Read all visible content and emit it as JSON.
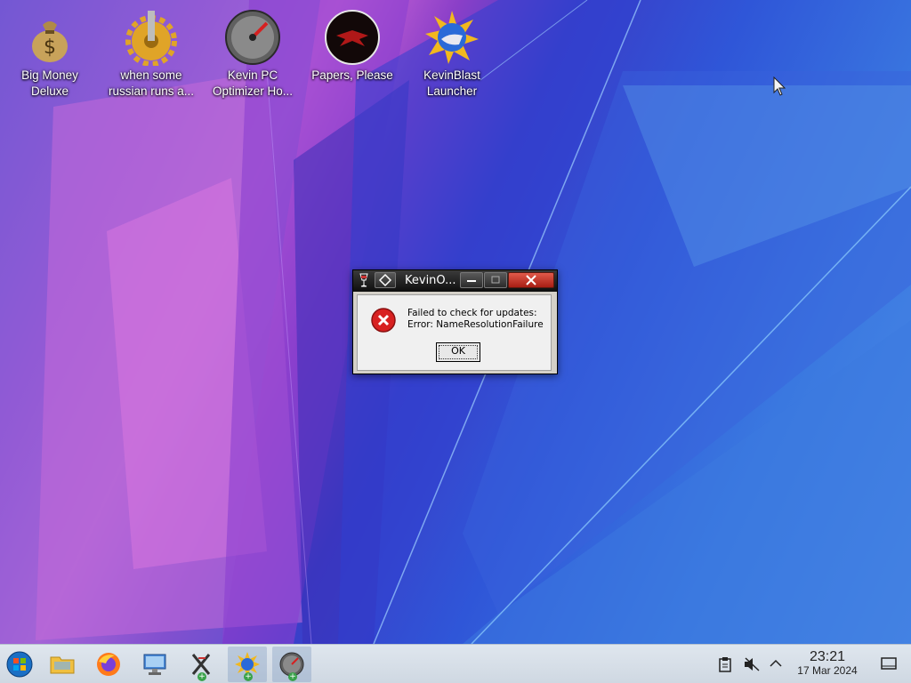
{
  "desktop": {
    "icons": [
      {
        "label": "Big Money Deluxe",
        "icon": "money-bag-icon"
      },
      {
        "label": "when some russian runs a...",
        "icon": "gear-icon"
      },
      {
        "label": "Kevin PC Optimizer Ho...",
        "icon": "gauge-icon"
      },
      {
        "label": "Papers, Please",
        "icon": "eagle-emblem-icon"
      },
      {
        "label": "KevinBlast Launcher",
        "icon": "sun-globe-icon"
      }
    ]
  },
  "dialog": {
    "title": "KevinO...",
    "message_line1": "Failed to check for updates:",
    "message_line2": "Error: NameResolutionFailure",
    "ok_label": "OK",
    "icon": "error-icon"
  },
  "taskbar": {
    "items": [
      {
        "name": "start-menu",
        "icon": "windows-orb-icon"
      },
      {
        "name": "file-manager",
        "icon": "folder-icon"
      },
      {
        "name": "firefox",
        "icon": "firefox-icon"
      },
      {
        "name": "control-panel",
        "icon": "computer-settings-icon"
      },
      {
        "name": "wine-x-app",
        "icon": "x-app-icon"
      },
      {
        "name": "kevinblast",
        "icon": "sun-globe-icon"
      },
      {
        "name": "kevin-pc-optimizer",
        "icon": "gauge-icon"
      }
    ],
    "tray": {
      "clipboard": "clipboard-icon",
      "volume": "volume-muted-icon",
      "expand": "chevron-up-icon",
      "show_desktop": "show-desktop-icon"
    },
    "clock": {
      "time": "23:21",
      "date": "17 Mar 2024"
    }
  }
}
